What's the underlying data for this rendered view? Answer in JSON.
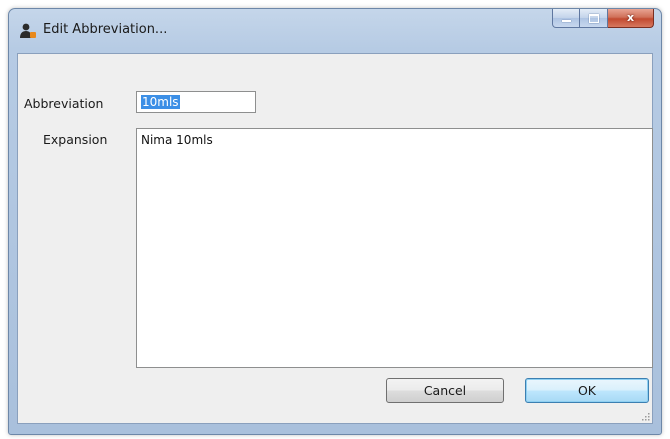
{
  "window": {
    "title": "Edit Abbreviation...",
    "icon": "app-person-icon",
    "controls": {
      "minimize": "minimize-icon",
      "maximize": "maximize-icon",
      "close": "close-icon",
      "close_glyph": "x"
    }
  },
  "form": {
    "abbreviation_label": "Abbreviation",
    "abbreviation_value": "10mls",
    "abbreviation_selected": true,
    "expansion_label": "Expansion",
    "expansion_value": "Nima 10mls"
  },
  "buttons": {
    "cancel_label": "Cancel",
    "ok_label": "OK"
  },
  "colors": {
    "selection": "#3c8fe6",
    "close_button": "#c24a30",
    "default_button_border": "#3c7fb1"
  }
}
